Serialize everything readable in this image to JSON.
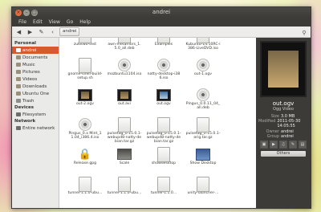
{
  "window": {
    "title": "andrei"
  },
  "menu": [
    "File",
    "Edit",
    "View",
    "Go",
    "Help"
  ],
  "toolbar": {
    "path": "andrei"
  },
  "sidebar": {
    "personal_header": "Personal",
    "personal": [
      "andrei",
      "Documents",
      "Music",
      "Pictures",
      "Videos",
      "Downloads",
      "Ubuntu One",
      "Trash"
    ],
    "devices_header": "Devices",
    "devices": [
      "Filesystem"
    ],
    "network_header": "Network",
    "network": [
      "Entire network"
    ]
  },
  "files": [
    {
      "label": "zukitwo-test",
      "icon": "folder-icon",
      "kind": "doc"
    },
    {
      "label": "awn-metamors_1.5.0_all.deb",
      "icon": "package-icon",
      "kind": "doc"
    },
    {
      "label": "Examples",
      "icon": "folder-icon",
      "kind": "doc"
    },
    {
      "label": "Kubuntu-14.10RC-i386-LiveDVD.iso",
      "icon": "disc-icon",
      "kind": "doc"
    },
    {
      "label": "",
      "icon": "",
      "kind": "none"
    },
    {
      "label": "gnome-shell-build-setup.sh",
      "icon": "script-icon",
      "kind": "doc"
    },
    {
      "label": "mozbuntu1104.iso",
      "icon": "disc-icon",
      "kind": "disc"
    },
    {
      "label": "natty-desktop-i386.iso",
      "icon": "disc-icon",
      "kind": "disc"
    },
    {
      "label": "out-1.ogv",
      "icon": "video-icon",
      "kind": "disc"
    },
    {
      "label": "",
      "icon": "",
      "kind": "none"
    },
    {
      "label": "out-2.ogv",
      "icon": "video-icon",
      "kind": "film"
    },
    {
      "label": "out.avi",
      "icon": "video-icon",
      "kind": "film"
    },
    {
      "label": "out.ogv",
      "icon": "video-icon",
      "kind": "film-blue"
    },
    {
      "label": "Pingus_0.0.11_04_all.deb",
      "icon": "package-icon",
      "kind": "disc"
    },
    {
      "label": "",
      "icon": "",
      "kind": "none"
    },
    {
      "label": "Pingus_0.x Mint_11.04_i386.4.iso",
      "icon": "disc-icon",
      "kind": "disc"
    },
    {
      "label": "pulsetag_0.15.0.1-webupd8-natty-debian.tar.gz",
      "icon": "archive-icon",
      "kind": "doc"
    },
    {
      "label": "pulsetag_0.15.0.1-webupd8-natty-debian.tar.gz",
      "icon": "archive-icon",
      "kind": "doc"
    },
    {
      "label": "pulsetag_0.15.0.1-orig.tar.gz",
      "icon": "archive-icon",
      "kind": "doc"
    },
    {
      "label": "",
      "icon": "",
      "kind": "none"
    },
    {
      "label": "Release.gpg",
      "icon": "key-icon",
      "kind": "lock"
    },
    {
      "label": "Scale",
      "icon": "monitor-icon",
      "kind": "monitor"
    },
    {
      "label": "showdesktop",
      "icon": "script-icon",
      "kind": "doc"
    },
    {
      "label": "Show Desktop",
      "icon": "desktop-icon",
      "kind": "desktop"
    },
    {
      "label": "",
      "icon": "",
      "kind": "none"
    },
    {
      "label": "tunnel-1.1.0-ubu...",
      "icon": "package-icon",
      "kind": "doc"
    },
    {
      "label": "tunnel-1.1.0-ubu...",
      "icon": "package-icon",
      "kind": "doc"
    },
    {
      "label": "tunnel-1.1.0...",
      "icon": "package-icon",
      "kind": "doc"
    },
    {
      "label": "unity-launcher-...",
      "icon": "debian-icon",
      "kind": "doc"
    },
    {
      "label": "",
      "icon": "",
      "kind": "none"
    }
  ],
  "preview": {
    "name": "out.ogv",
    "type": "Ogg Video",
    "fields": [
      {
        "k": "Size",
        "v": "3.0 MB"
      },
      {
        "k": "Modified",
        "v": "2011-05-30 14:05:55"
      },
      {
        "k": "Owner",
        "v": "andrei"
      },
      {
        "k": "Group",
        "v": "andrei"
      }
    ],
    "others_label": "Others"
  }
}
